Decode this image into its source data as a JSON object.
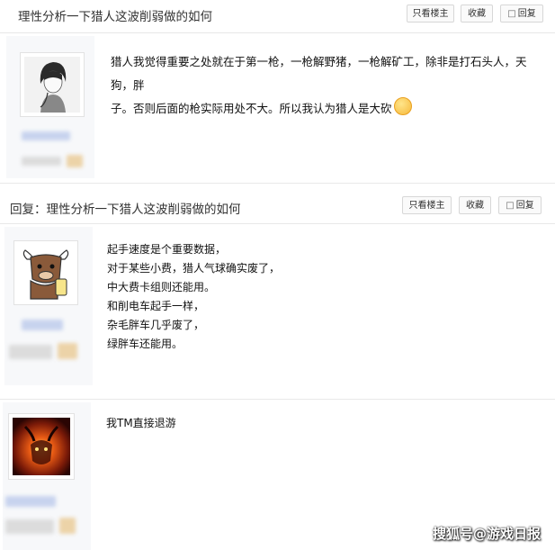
{
  "posts": [
    {
      "title": "理性分析一下猎人这波削弱做的如何",
      "buttons": {
        "only_op": "只看楼主",
        "favorite": "收藏",
        "reply": "回复"
      },
      "content_lines": [
        "猎人我觉得重要之处就在于第一枪，一枪解野猪，一枪解矿工，除非是打石头人，天狗，胖",
        "子。否则后面的枪实际用处不大。所以我认为猎人是大砍"
      ],
      "emoji_icon": "pensive-face-emoji"
    },
    {
      "title": "回复：理性分析一下猎人这波削弱做的如何",
      "buttons": {
        "only_op": "只看楼主",
        "favorite": "收藏",
        "reply": "回复"
      },
      "content_lines": [
        "起手速度是个重要数据，",
        "对于某些小费，猎人气球确实废了，",
        "中大费卡组则还能用。",
        "和削电车起手一样，",
        "杂毛胖车几乎废了，",
        "绿胖车还能用。"
      ]
    },
    {
      "content_lines": [
        "我TM直接退游"
      ]
    }
  ],
  "watermark": "搜狐号@游戏日报",
  "icons": {
    "reply": "speech-bubble-icon"
  }
}
